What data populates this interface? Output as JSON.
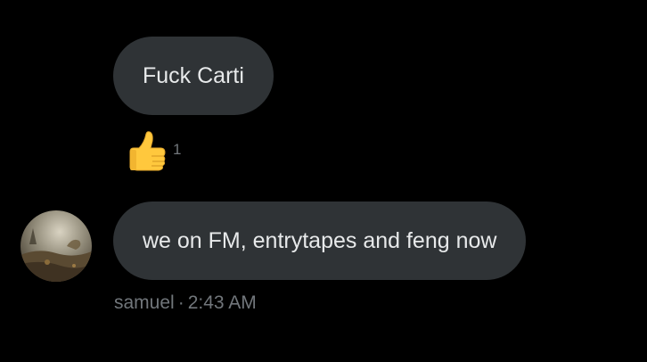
{
  "messages": [
    {
      "text": "Fuck Carti",
      "reaction": {
        "emoji": "thumbs-up-icon",
        "count": "1"
      }
    },
    {
      "text": "we on FM, entrytapes and feng now",
      "author": "samuel",
      "separator": "·",
      "time": "2:43 AM"
    }
  ],
  "colors": {
    "background": "#000000",
    "bubble": "#2f3336",
    "text": "#e7e9ea",
    "muted": "#71767b",
    "emoji": "#ffc83d"
  }
}
